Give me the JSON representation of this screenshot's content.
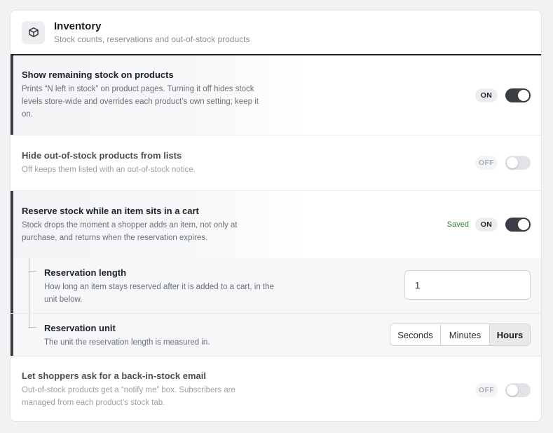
{
  "header": {
    "icon": "box-icon",
    "title": "Inventory",
    "subtitle": "Stock counts, reservations and out-of-stock products"
  },
  "settings": [
    {
      "title": "Show remaining stock on products",
      "description": "Prints “N left in stock” on product pages. Turning it off hides stock levels store-wide and overrides each product’s own setting; keep it on.",
      "state_label": "ON",
      "enabled": true
    },
    {
      "title": "Hide out-of-stock products from lists",
      "description": "Off keeps them listed with an out-of-stock notice.",
      "state_label": "OFF",
      "enabled": false
    },
    {
      "title": "Reserve stock while an item sits in a cart",
      "description": "Stock drops the moment a shopper adds an item, not only at purchase, and returns when the reservation expires.",
      "state_label": "ON",
      "enabled": true,
      "saved_label": "Saved"
    },
    {
      "title": "Let shoppers ask for a back-in-stock email",
      "description": "Out-of-stock products get a “notify me” box. Subscribers are managed from each product’s stock tab.",
      "state_label": "OFF",
      "enabled": false
    }
  ],
  "reservation": {
    "length": {
      "title": "Reservation length",
      "description": "How long an item stays reserved after it is added to a cart, in the unit below.",
      "value": "1"
    },
    "unit": {
      "title": "Reservation unit",
      "description": "The unit the reservation length is measured in.",
      "options": [
        "Seconds",
        "Minutes",
        "Hours"
      ],
      "selected": "Hours"
    }
  },
  "colors": {
    "accent": "#3b3f45",
    "saved": "#2e7d32",
    "background": "#f1f2f4"
  }
}
